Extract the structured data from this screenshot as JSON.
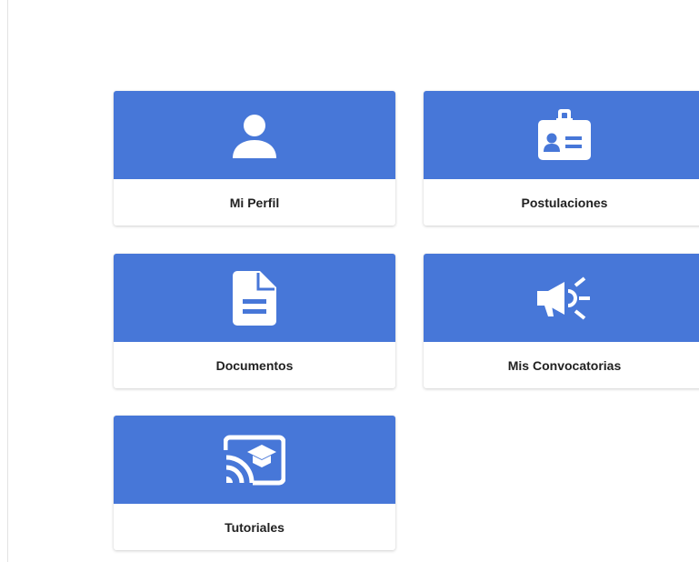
{
  "theme": {
    "card_header_color": "#4777d8",
    "icon_color": "#ffffff",
    "label_color": "#212121"
  },
  "menu": {
    "items": [
      {
        "label": "Mi Perfil",
        "icon": "person-icon"
      },
      {
        "label": "Postulaciones",
        "icon": "id-badge-icon"
      },
      {
        "label": "Documentos",
        "icon": "document-icon"
      },
      {
        "label": "Mis Convocatorias",
        "icon": "megaphone-icon"
      },
      {
        "label": "Tutoriales",
        "icon": "cast-for-education-icon"
      }
    ]
  }
}
